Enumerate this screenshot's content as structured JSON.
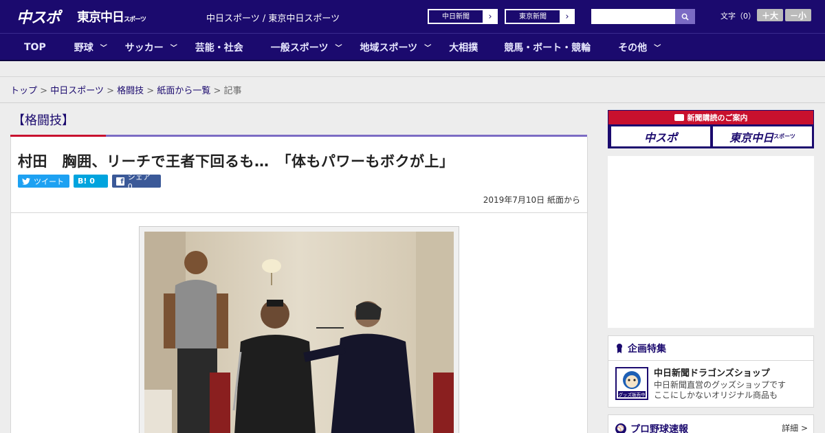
{
  "header": {
    "logo_primary": "中スポ",
    "logo_secondary": "東京中日",
    "logo_secondary_small": "スポーツ",
    "tagline": "中日スポーツ / 東京中日スポーツ",
    "link_chunichi": "中日新聞",
    "link_tokyo": "東京新聞",
    "search_placeholder": "",
    "fontsize_label": "文字（0）",
    "font_bigger": "＋大",
    "font_smaller": "－小"
  },
  "nav": {
    "items": [
      {
        "label": "TOP",
        "has_menu": false
      },
      {
        "label": "野球",
        "has_menu": true
      },
      {
        "label": "サッカー",
        "has_menu": true
      },
      {
        "label": "芸能・社会",
        "has_menu": false
      },
      {
        "label": "一般スポーツ",
        "has_menu": true
      },
      {
        "label": "地域スポーツ",
        "has_menu": true
      },
      {
        "label": "大相撲",
        "has_menu": false
      },
      {
        "label": "競馬・ボート・競輪",
        "has_menu": false
      },
      {
        "label": "その他",
        "has_menu": true
      }
    ]
  },
  "breadcrumb": {
    "items": [
      "トップ",
      "中日スポーツ",
      "格闘技",
      "紙面から一覧"
    ],
    "current": "記事",
    "separator": ">"
  },
  "article": {
    "category": "【格闘技】",
    "title": "村田　胸囲、リーチで王者下回るも…　「体もパワーもボクが上」",
    "share_tweet": "ツイート",
    "share_hatena": "B! 0",
    "share_facebook": "シェア 0",
    "date": "2019年7月10日 紙面から"
  },
  "sidebar": {
    "promo_header": "新聞購読のご案内",
    "promo_btn1": "中スポ",
    "promo_btn2": "東京中日",
    "promo_btn2_small": "スポーツ",
    "feature_heading": "企画特集",
    "feature_title": "中日新聞ドラゴンズショップ",
    "feature_desc1": "中日新聞直営のグッズショップです",
    "feature_desc2": "ここにしかないオリジナル商品も",
    "feature_thumb_text": "グッズ販売中",
    "baseball_heading": "プロ野球速報",
    "baseball_more": "詳細 >"
  },
  "colors": {
    "brand_navy": "#1b0a6e",
    "accent_red": "#c8102e",
    "accent_purple": "#7b6bc4"
  }
}
